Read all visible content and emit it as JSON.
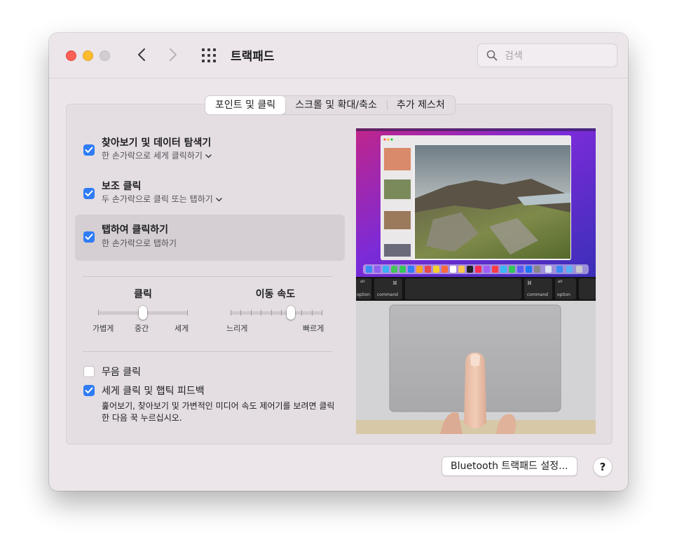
{
  "window": {
    "title": "트랙패드",
    "search": {
      "placeholder": "검색",
      "value": ""
    }
  },
  "tabs": [
    {
      "label": "포인트 및 클릭",
      "active": true
    },
    {
      "label": "스크롤 및 확대/축소",
      "active": false
    },
    {
      "label": "추가 제스처",
      "active": false
    }
  ],
  "options": [
    {
      "title": "찾아보기 및 데이터 탐색기",
      "subtitle": "한 손가락으로 세게 클릭하기",
      "checked": true,
      "has_dropdown": true
    },
    {
      "title": "보조 클릭",
      "subtitle": "두 손가락으로 클릭 또는 탭하기",
      "checked": true,
      "has_dropdown": true
    },
    {
      "title": "탭하여 클릭하기",
      "subtitle": "한 손가락으로 탭하기",
      "checked": true,
      "selected": true,
      "has_dropdown": false
    }
  ],
  "sliders": {
    "click": {
      "label": "클릭",
      "min_label": "가볍게",
      "mid_label": "중간",
      "max_label": "세게",
      "positions": 3,
      "value_index": 1
    },
    "tracking": {
      "label": "이동 속도",
      "min_label": "느리게",
      "max_label": "빠르게",
      "positions": 10,
      "value_index": 7
    }
  },
  "bottom_options": [
    {
      "title": "무음 클릭",
      "checked": false
    },
    {
      "title": "세게 클릭 및 햅틱 피드백",
      "checked": true
    }
  ],
  "description": "훑어보기, 찾아보기 및 가변적인 미디어 속도 제어기를 보려면 클릭한 다음 꾹 누르십시오.",
  "preview": {
    "keys": {
      "alt": "alt",
      "option": "option",
      "cmd_symbol": "⌘",
      "command": "command"
    }
  },
  "footer": {
    "bluetooth_button": "Bluetooth 트랙패드 설정...",
    "help_button": "?"
  },
  "colors": {
    "accent": "#2f7cf6",
    "window_bg": "#ece6ea",
    "close": "#fe5f57",
    "minimize": "#febc2e"
  }
}
